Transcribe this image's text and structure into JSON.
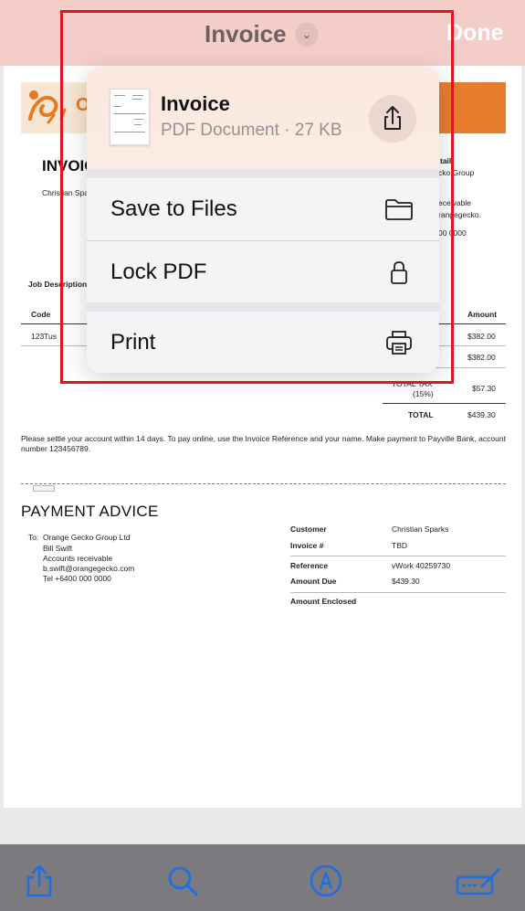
{
  "nav": {
    "title": "Invoice",
    "done": "Done"
  },
  "popover": {
    "doc_name": "Invoice",
    "doc_meta": "PDF Document · 27 KB",
    "actions": [
      {
        "label": "Save to Files",
        "icon": "folder-icon"
      },
      {
        "label": "Lock PDF",
        "icon": "lock-icon"
      },
      {
        "label": "Print",
        "icon": "printer-icon"
      }
    ]
  },
  "document": {
    "logo_text": "Ora",
    "title_partial": "INVOIC",
    "client_partial": "Christian Spa",
    "right_header_partial": "tail",
    "right_lines": [
      "cko Group",
      "eceivable",
      "rangegecko.",
      "00 0000"
    ],
    "job_description": "Job Description:",
    "table": {
      "code_header": "Code",
      "amount_header": "Amount",
      "row_code": "123Tus",
      "row_amount": "$382.00",
      "subtotal": "$382.00",
      "tax_label": "TOTAL TAX",
      "tax_rate": "(15%)",
      "tax_amount": "$57.30",
      "total_label": "TOTAL",
      "total_amount": "$439.30"
    },
    "settle_text": "Please settle your account within 14 days. To pay online, use the Invoice Reference and your name. Make payment to Payville Bank, account",
    "settle_text2": "number 123456789.",
    "payment_advice": {
      "title": "PAYMENT ADVICE",
      "to_label": "To:",
      "address": [
        "Orange Gecko Group Ltd",
        "Bill Swift",
        "Accounts receivable",
        "b.swift@orangegecko.com",
        "Tel +6400 000 0000"
      ],
      "fields": [
        {
          "label": "Customer",
          "value": "Christian Sparks"
        },
        {
          "label": "Invoice #",
          "value": "TBD"
        },
        {
          "label": "Reference",
          "value": "vWork 40259730"
        },
        {
          "label": "Amount Due",
          "value": "$439.30"
        },
        {
          "label": "Amount Enclosed",
          "value": ""
        }
      ]
    }
  },
  "toolbar": {
    "items": [
      "share-icon",
      "search-icon",
      "markup-icon",
      "form-fill-icon"
    ]
  }
}
